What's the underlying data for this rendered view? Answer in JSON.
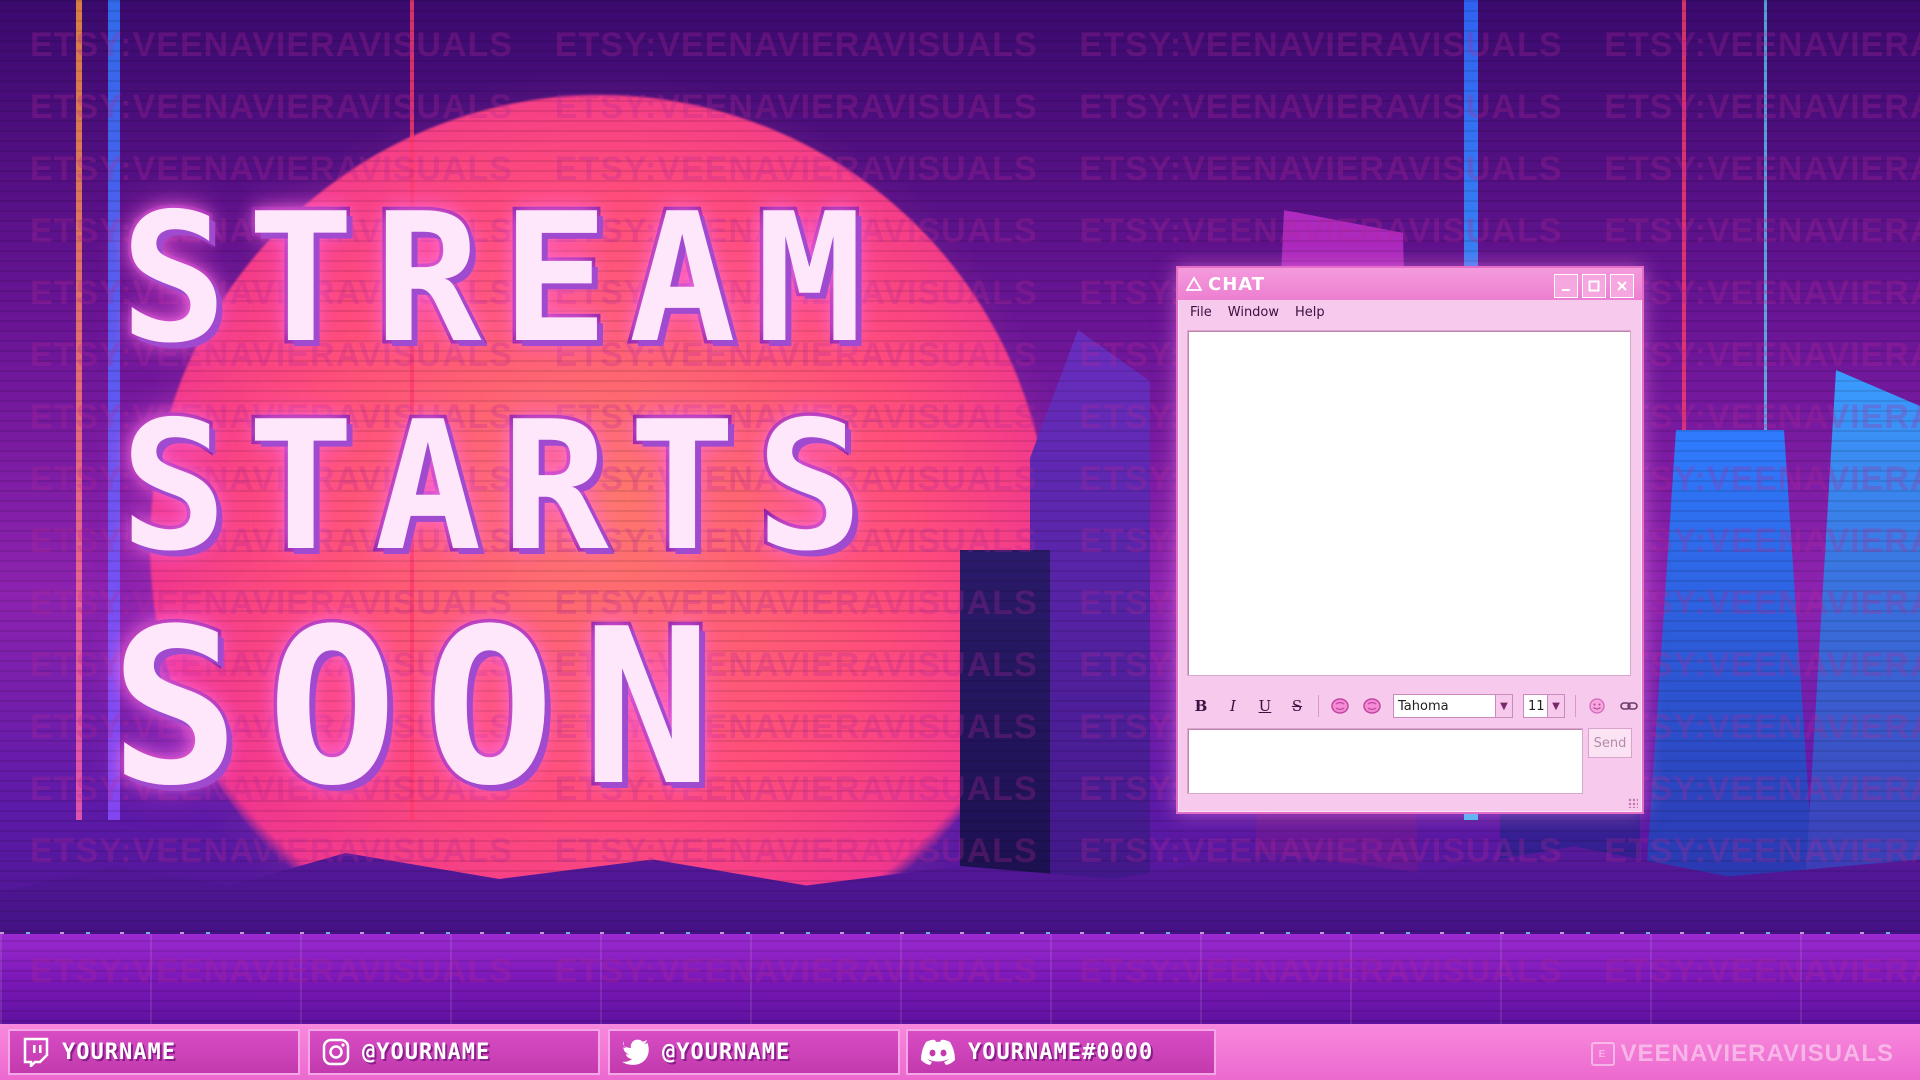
{
  "headline": {
    "line1": "STREAM",
    "line2": "STARTS",
    "line3": "SOON"
  },
  "watermark": {
    "text": "ETSY:VEENAVIERAVISUALS"
  },
  "chat_window": {
    "title": "CHAT",
    "icon": "warning-triangle-icon",
    "window_buttons": [
      "minimize",
      "maximize",
      "close"
    ],
    "menu": [
      "File",
      "Window",
      "Help"
    ],
    "toolbar": {
      "bold": "B",
      "italic": "I",
      "underline": "U",
      "strikethrough": "S",
      "font": "Tahoma",
      "size": "11"
    },
    "send_label": "Send"
  },
  "socials": [
    {
      "icon": "twitch-icon",
      "label": "YOURNAME"
    },
    {
      "icon": "instagram-icon",
      "label": "@YOURNAME"
    },
    {
      "icon": "twitter-icon",
      "label": "@YOURNAME"
    },
    {
      "icon": "discord-icon",
      "label": "YOURNAME#0000"
    }
  ],
  "brand": {
    "text": "VEENAVIERAVISUALS"
  },
  "colors": {
    "accent_pink": "#ec69cf",
    "text_fill": "#ffe7fb",
    "text_stroke": "#7a1aa0",
    "chat_bg": "#f7c9ec"
  }
}
